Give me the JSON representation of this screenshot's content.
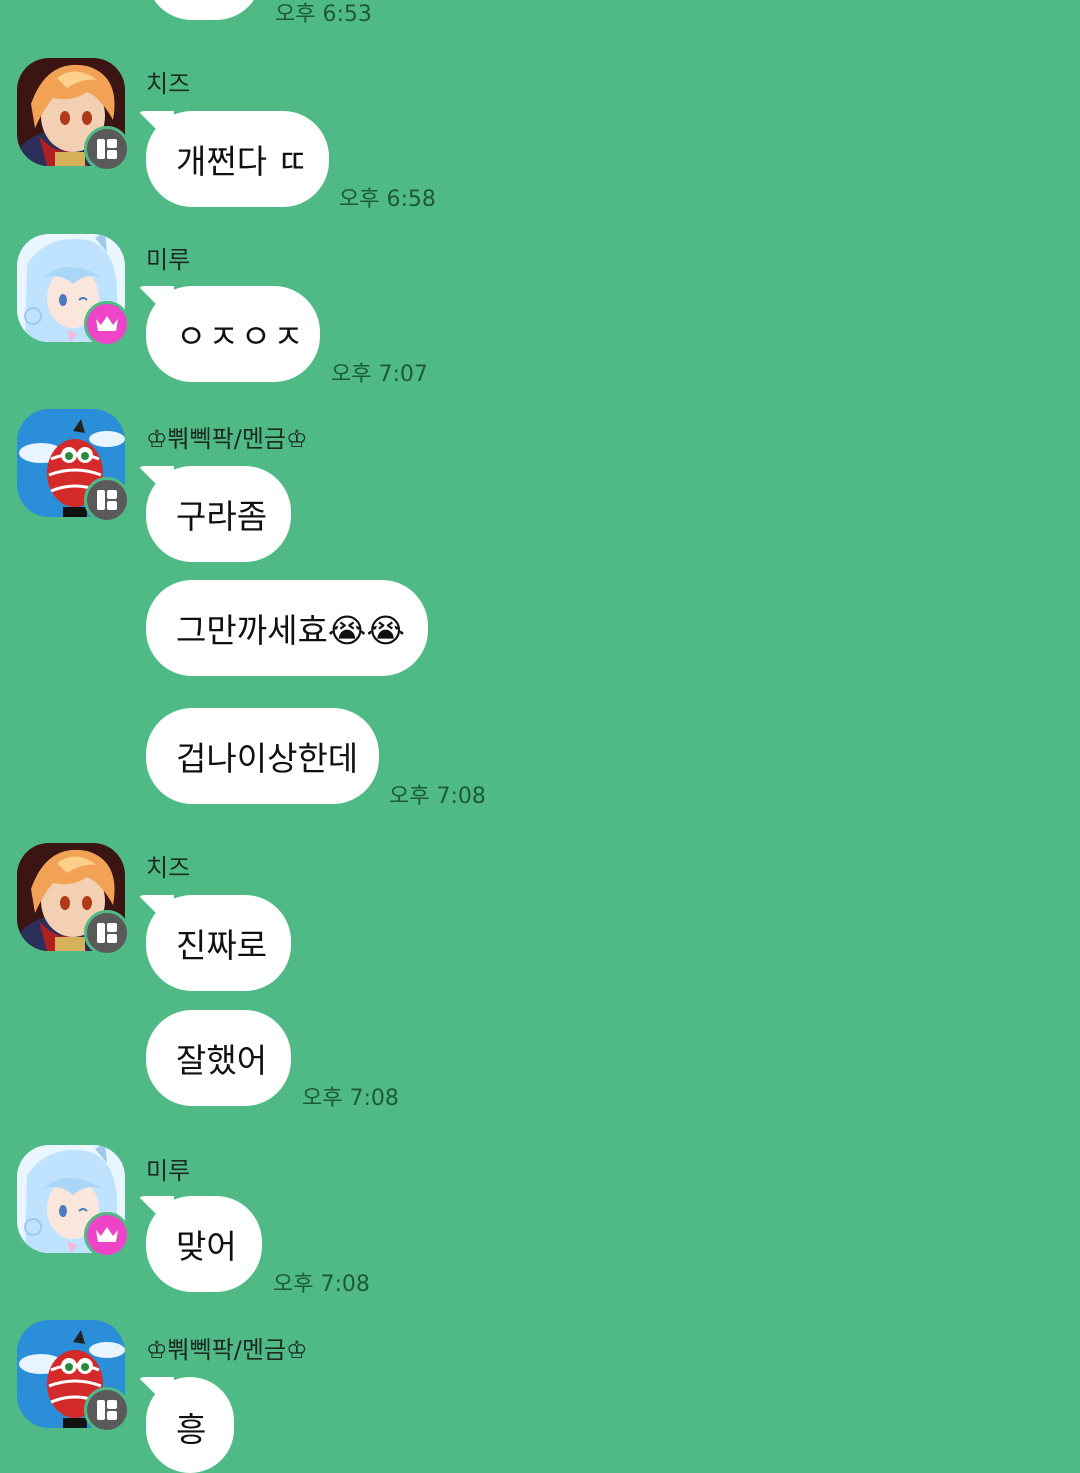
{
  "header": {
    "partial_time": "오후 6:53"
  },
  "messages": [
    {
      "sender": "치즈",
      "texts": [
        "개쩐다 ㄸ"
      ],
      "time": "오후 6:58"
    },
    {
      "sender": "미루",
      "texts": [
        "ㅇㅈㅇㅈ"
      ],
      "time": "오후 7:07"
    },
    {
      "sender": "♔뿨뻭팍/멘금♔",
      "texts": [
        "구라좀",
        "그만까세효😭😭",
        "겁나이상한데"
      ],
      "time": "오후 7:08"
    },
    {
      "sender": "치즈",
      "texts": [
        "진짜로",
        "잘했어"
      ],
      "time": "오후 7:08"
    },
    {
      "sender": "미루",
      "texts": [
        "맞어"
      ],
      "time": "오후 7:08"
    },
    {
      "sender": "♔뿨뻭팍/멘금♔",
      "texts": [
        "흥"
      ]
    }
  ],
  "avatars": {
    "cheese": "orange-hair-anime-boy-avatar",
    "miru": "blue-hair-anime-girl-avatar",
    "ppwi": "red-mascot-creature-avatar"
  },
  "badges": {
    "member": "member-grid-icon",
    "owner": "crown-icon"
  },
  "colors": {
    "background": "#4fba85",
    "bubble": "#ffffff",
    "owner_badge": "#ee45c8",
    "member_badge": "#5a5a5a"
  }
}
